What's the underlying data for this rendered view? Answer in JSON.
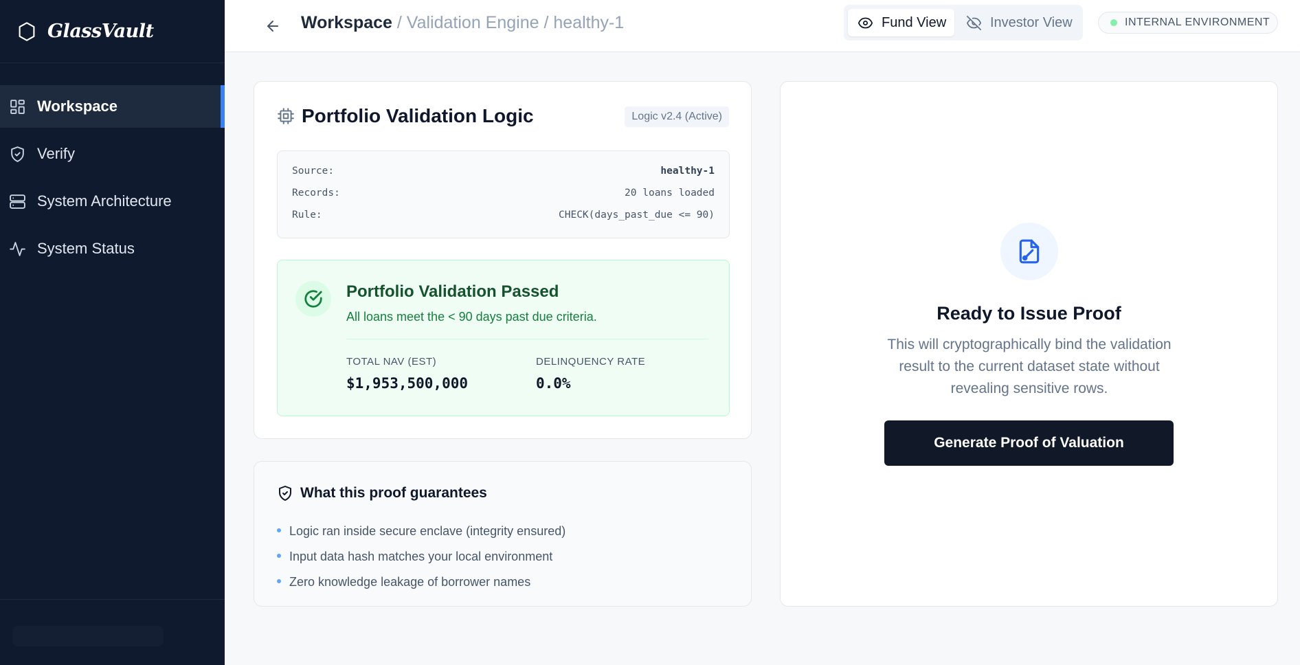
{
  "brand": {
    "name": "GlassVault",
    "icon": "hexagon-icon"
  },
  "sidebar": {
    "items": [
      {
        "label": "Workspace",
        "icon": "dashboard-icon",
        "active": true
      },
      {
        "label": "Verify",
        "icon": "shield-check-icon",
        "active": false
      },
      {
        "label": "System Architecture",
        "icon": "server-icon",
        "active": false
      },
      {
        "label": "System Status",
        "icon": "activity-icon",
        "active": false
      }
    ]
  },
  "topbar": {
    "breadcrumb_main": "Workspace",
    "breadcrumb_rest": "/ Validation Engine / healthy-1",
    "fund_view": "Fund View",
    "investor_view": "Investor View",
    "environment": "INTERNAL ENVIRONMENT"
  },
  "validation": {
    "title": "Portfolio Validation Logic",
    "version": "Logic v2.4 (Active)",
    "meta": [
      {
        "label": "Source:",
        "value": "healthy-1"
      },
      {
        "label": "Records:",
        "value": "20 loans loaded"
      },
      {
        "label": "Rule:",
        "value": "CHECK(days_past_due <= 90)"
      }
    ],
    "result": {
      "title": "Portfolio Validation Passed",
      "subtitle": "All loans meet the < 90 days past due criteria.",
      "nav_label": "TOTAL NAV (EST)",
      "nav_value": "$1,953,500,000",
      "delinquency_label": "DELINQUENCY RATE",
      "delinquency_value": "0.0%"
    }
  },
  "guarantees": {
    "title": "What this proof guarantees",
    "items": [
      "Logic ran inside secure enclave (integrity ensured)",
      "Input data hash matches your local environment",
      "Zero knowledge leakage of borrower names"
    ]
  },
  "proof": {
    "title": "Ready to Issue Proof",
    "description": "This will cryptographically bind the validation result to the current dataset state without revealing sensitive rows.",
    "button": "Generate Proof of Valuation"
  },
  "colors": {
    "sidebar_bg": "#0f1a2e",
    "accent": "#3b82f6",
    "success": "#15803d",
    "primary_button": "#111827"
  }
}
